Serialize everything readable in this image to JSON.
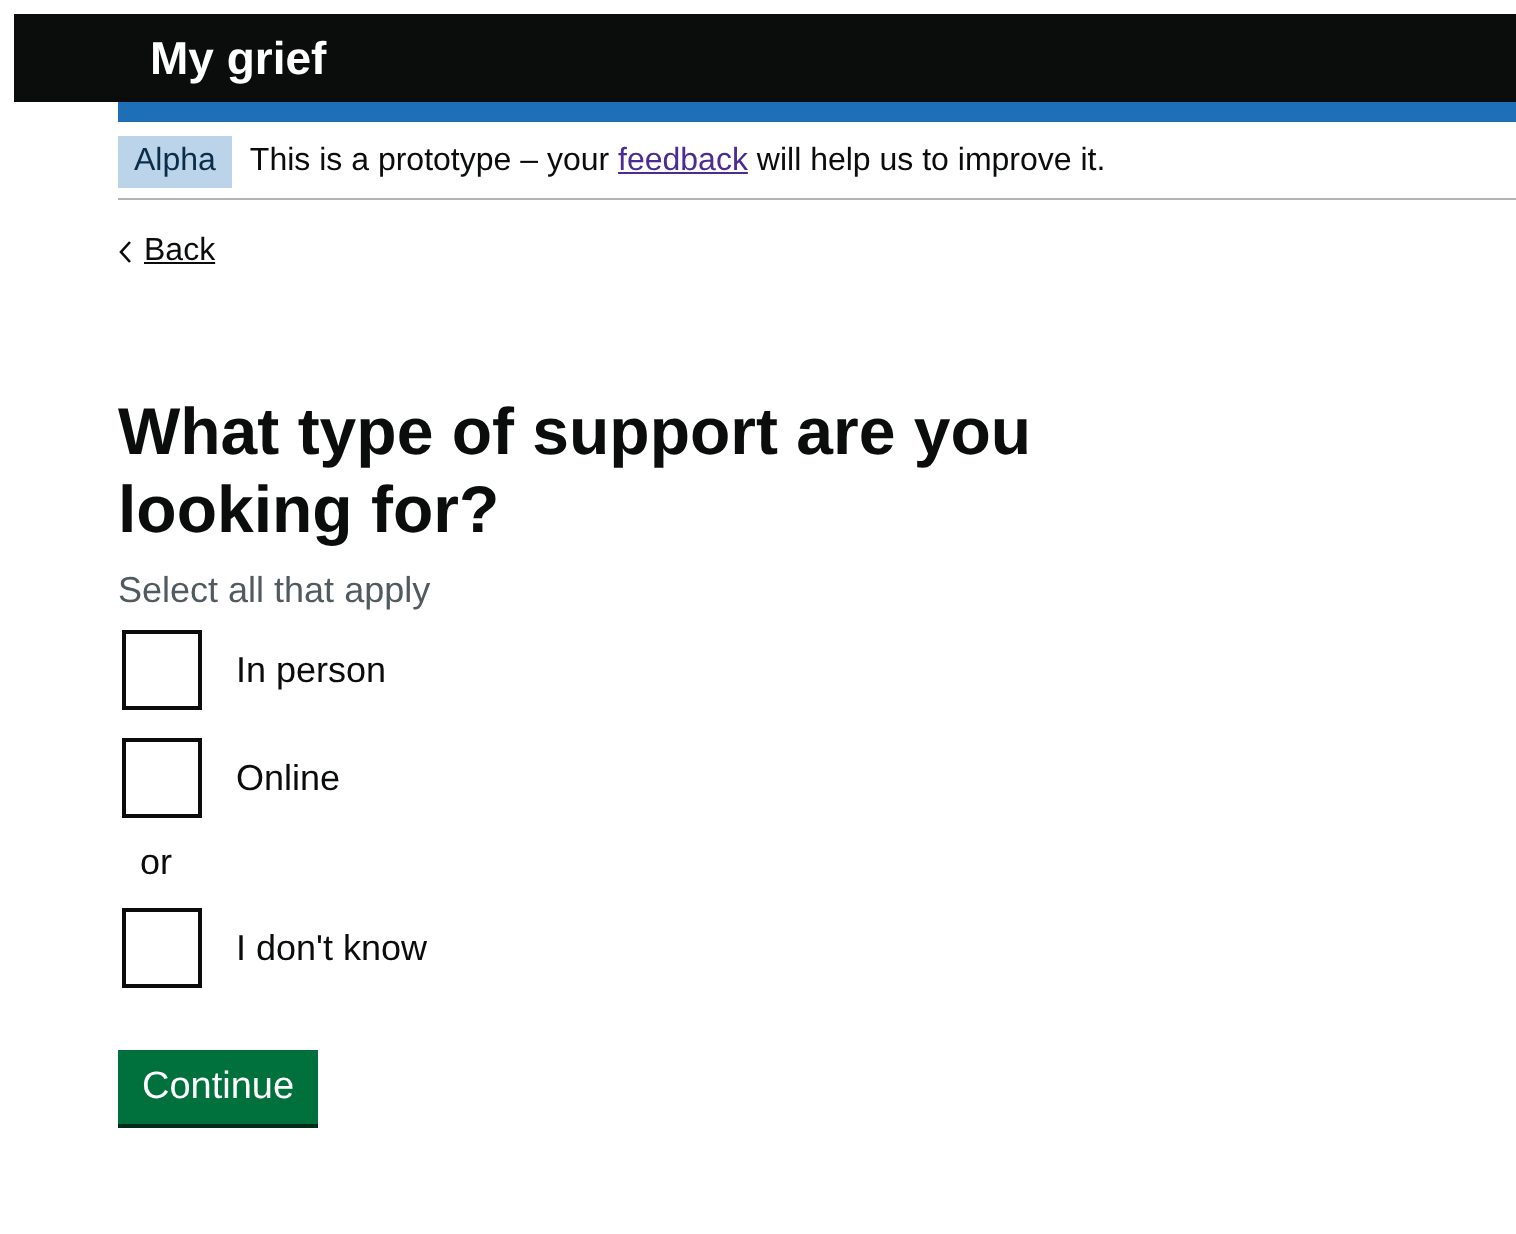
{
  "header": {
    "title": "My grief"
  },
  "phase_banner": {
    "tag": "Alpha",
    "text_before": "This is a prototype – your",
    "link": "feedback",
    "text_after": "will help us to improve it."
  },
  "back_link": "Back",
  "question": {
    "heading": "What type of support are you looking for?",
    "hint": "Select all that apply",
    "options": [
      {
        "kind": "checkbox",
        "label": "In person",
        "checked": false
      },
      {
        "kind": "checkbox",
        "label": "Online",
        "checked": false
      },
      {
        "kind": "divider",
        "label": "or"
      },
      {
        "kind": "checkbox",
        "label": "I don't know",
        "checked": false
      }
    ]
  },
  "button": "Continue"
}
